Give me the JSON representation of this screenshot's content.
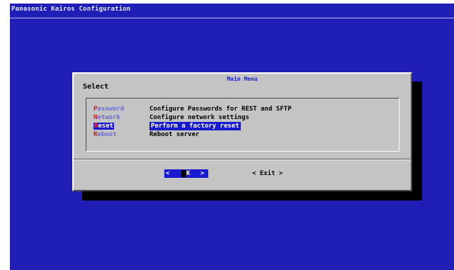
{
  "backtitle": "Panasonic Kairos Configuration",
  "dialog": {
    "title": "Main Menu",
    "prompt": "Select",
    "items": [
      {
        "hotkey": "P",
        "rest": "assword",
        "description": "Configure Passwords for REST and SFTP",
        "selected": false
      },
      {
        "hotkey": "N",
        "rest": "etwork",
        "description": "Configure network settings",
        "selected": false
      },
      {
        "hotkey": "R",
        "rest": "eset",
        "description": "Perform a factory reset",
        "selected": true
      },
      {
        "hotkey": "R",
        "rest": "eboot",
        "description": "Reboot server",
        "selected": false
      }
    ],
    "buttons": {
      "ok": {
        "open": "<",
        "label": "K",
        "close": ">"
      },
      "exit": "< Exit >"
    }
  },
  "colors": {
    "screen_bg": "#1f1fb8",
    "dialog_bg": "#c4c4c4",
    "highlight": "#1a1ad0",
    "hotkey": "#d01818",
    "tag_text": "#6b6bd0"
  }
}
